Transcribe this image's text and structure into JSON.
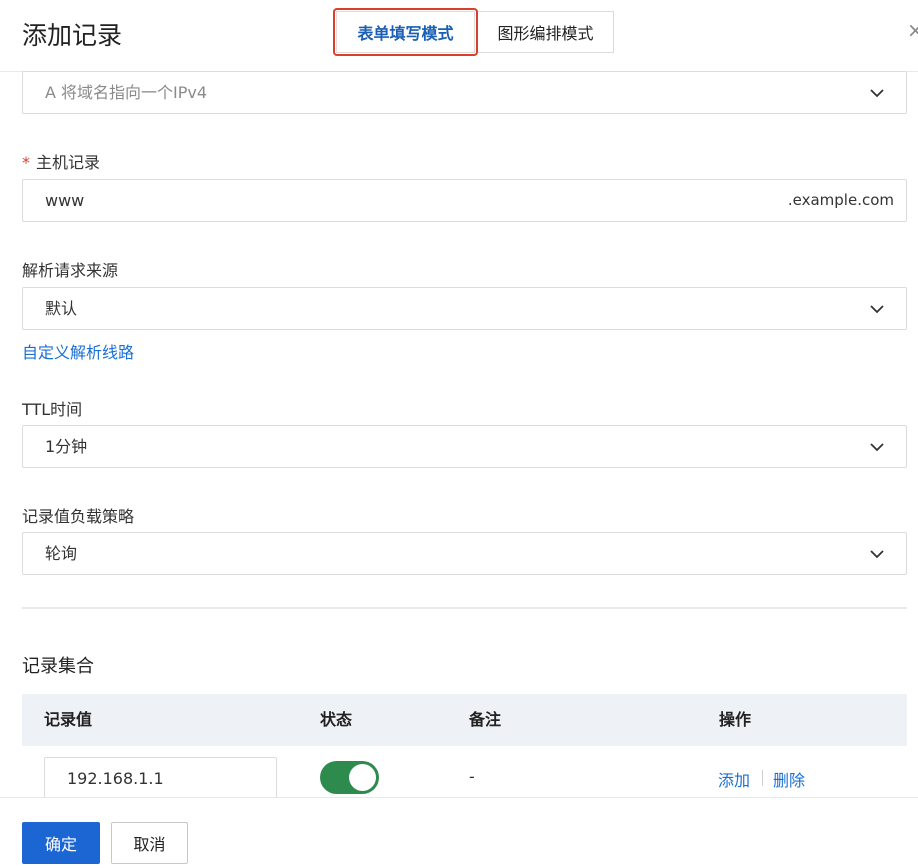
{
  "header": {
    "title": "添加记录",
    "mode_form": "表单填写模式",
    "mode_graph": "图形编排模式",
    "close_glyph": "×"
  },
  "record_type": {
    "value": "A 将域名指向一个IPv4"
  },
  "host": {
    "label": "主机记录",
    "required_mark": "*",
    "value": "www",
    "suffix": ".example.com"
  },
  "source": {
    "label": "解析请求来源",
    "value": "默认",
    "custom_link": "自定义解析线路"
  },
  "ttl": {
    "label": "TTL时间",
    "value": "1分钟"
  },
  "strategy": {
    "label": "记录值负载策略",
    "value": "轮询"
  },
  "record_set": {
    "title": "记录集合",
    "columns": [
      "记录值",
      "状态",
      "备注",
      "操作"
    ],
    "rows": [
      {
        "value": "192.168.1.1",
        "enabled": true,
        "remark": "-",
        "action_add": "添加",
        "action_delete": "删除"
      }
    ]
  },
  "footer": {
    "confirm": "确定",
    "cancel": "取消"
  },
  "colors": {
    "accent": "#1c66d4",
    "link": "#1a6fd3",
    "toggle_on": "#2e8b4e",
    "highlight": "#d9402c"
  },
  "icons": {
    "dropdown": "chevron-down-icon",
    "close": "close-icon"
  }
}
